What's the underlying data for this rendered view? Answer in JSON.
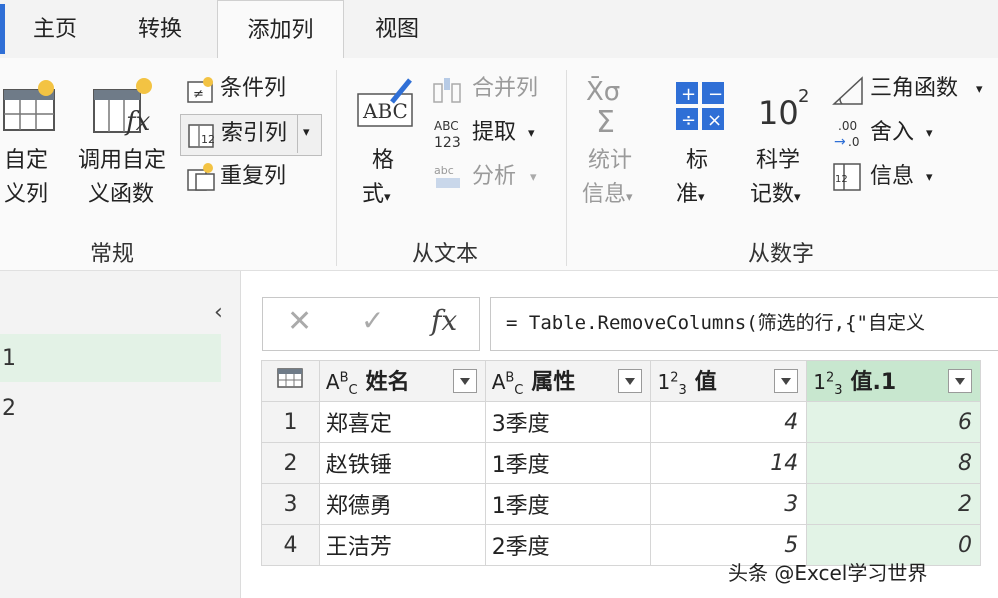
{
  "tabs": [
    {
      "label": "主页"
    },
    {
      "label": "转换"
    },
    {
      "label": "添加列"
    },
    {
      "label": "视图"
    }
  ],
  "ribbon": {
    "general": {
      "custom_column": [
        "自定",
        "义列"
      ],
      "invoke_custom_function": [
        "调用自定",
        "义函数"
      ],
      "conditional_column": "条件列",
      "index_column": "索引列",
      "duplicate_column": "重复列",
      "group_label": "常规"
    },
    "from_text": {
      "format": [
        "格",
        "式"
      ],
      "merge_columns": "合并列",
      "extract": "提取",
      "parse": "分析",
      "group_label": "从文本"
    },
    "from_number": {
      "statistics": [
        "统计",
        "信息"
      ],
      "standard": [
        "标",
        "准"
      ],
      "scientific": [
        "科学",
        "记数"
      ],
      "trigonometry": "三角函数",
      "rounding": "舍入",
      "information": "信息",
      "group_label": "从数字"
    }
  },
  "left_pane": {
    "queries": [
      "1",
      "2"
    ]
  },
  "formula_bar": {
    "formula": "= Table.RemoveColumns(筛选的行,{\"自定义"
  },
  "table": {
    "columns": [
      {
        "type_prefix": "A",
        "type_sup": "B",
        "type_sub": "C",
        "name": "姓名"
      },
      {
        "type_prefix": "A",
        "type_sup": "B",
        "type_sub": "C",
        "name": "属性"
      },
      {
        "type_prefix": "1",
        "type_sup": "2",
        "type_sub": "3",
        "name": "值"
      },
      {
        "type_prefix": "1",
        "type_sup": "2",
        "type_sub": "3",
        "name": "值.1"
      }
    ],
    "rows": [
      {
        "n": "1",
        "name": "郑喜定",
        "attr": "3季度",
        "v": "4",
        "v1": "6"
      },
      {
        "n": "2",
        "name": "赵铁锤",
        "attr": "1季度",
        "v": "14",
        "v1": "8"
      },
      {
        "n": "3",
        "name": "郑德勇",
        "attr": "1季度",
        "v": "3",
        "v1": "2"
      },
      {
        "n": "4",
        "name": "王洁芳",
        "attr": "2季度",
        "v": "5",
        "v1": "0"
      }
    ]
  },
  "watermark": "头条 @Excel学习世界",
  "colors": {
    "accent": "#2f6fd6",
    "selected_column": "#e2f3e6",
    "selected_header": "#c8e7cf"
  }
}
